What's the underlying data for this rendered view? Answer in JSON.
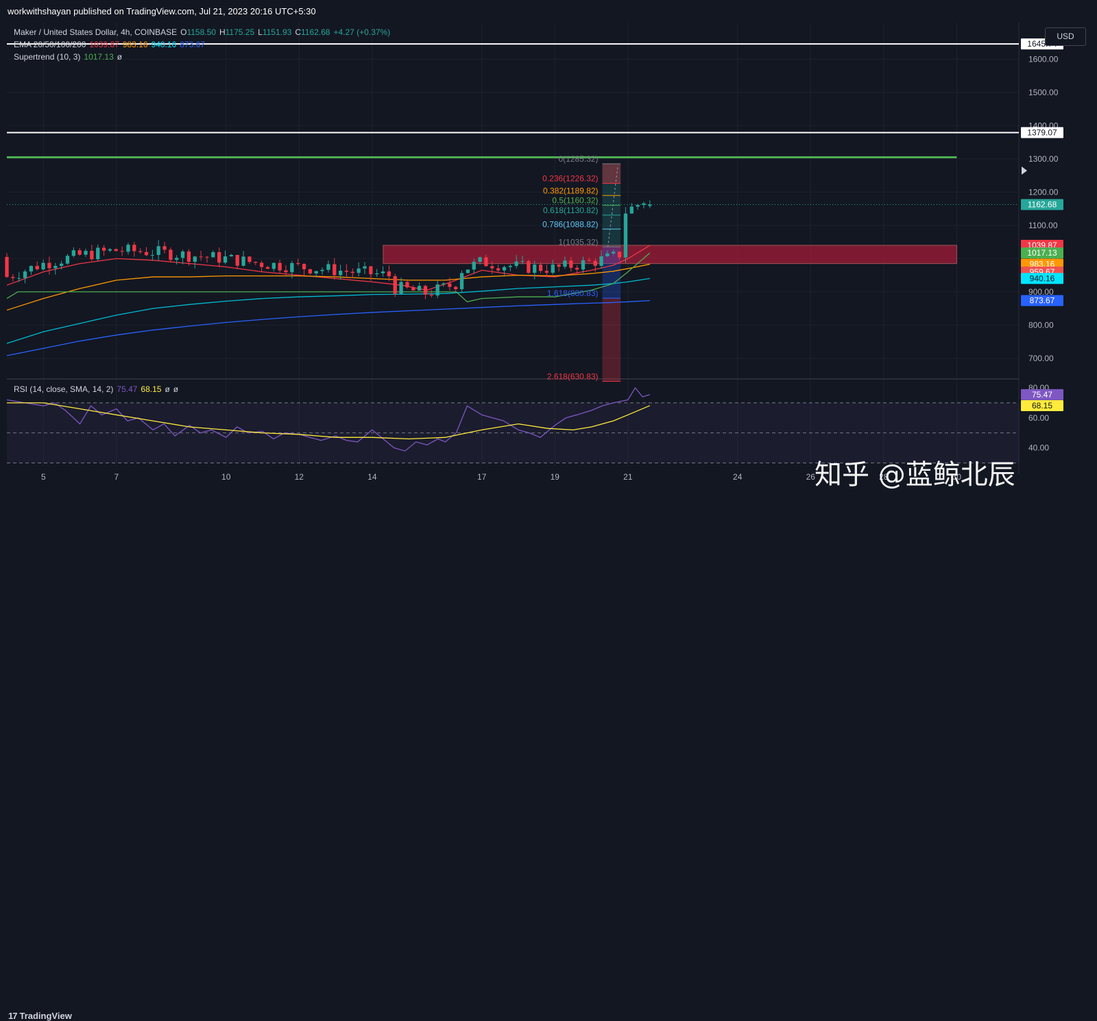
{
  "header": {
    "published_text": "workwithshayan published on TradingView.com, Jul 21, 2023 20:16 UTC+5:30"
  },
  "legend": {
    "symbol": "Maker / United States Dollar, 4h, COINBASE",
    "open_label": "O",
    "open": "1158.50",
    "high_label": "H",
    "high": "1175.25",
    "low_label": "L",
    "low": "1151.93",
    "close_label": "C",
    "close": "1162.68",
    "change": "+4.27 (+0.37%)",
    "ema_label": "EMA 20/50/100/200",
    "ema20": "1039.87",
    "ema50": "983.16",
    "ema100": "940.16",
    "ema200": "873.67",
    "supertrend_label": "Supertrend (10, 3)",
    "supertrend": "1017.13",
    "null_glyph": "ø",
    "rsi_label": "RSI (14, close, SMA, 14, 2)",
    "rsi": "75.47",
    "rsi_sma": "68.15"
  },
  "currency_button": "USD",
  "watermark": "知乎 @蓝鲸北辰",
  "footer": {
    "brand_mark": "17",
    "brand": "TradingView"
  },
  "colors": {
    "up": "#26a69a",
    "down": "#f23645",
    "ema20": "#f23645",
    "ema50": "#ff9800",
    "ema100": "#00bcd4",
    "ema200": "#2962ff",
    "supertrend": "#4caf50",
    "rsi": "#7e57c2",
    "rsi_sma": "#ffeb3b"
  },
  "chart_data": [
    {
      "type": "candlestick",
      "title": "Maker / United States Dollar, 4h, COINBASE",
      "ylim": [
        640,
        1710
      ],
      "y_ticks": [
        700,
        800,
        900,
        1000,
        1100,
        1200,
        1300,
        1400,
        1500,
        1600
      ],
      "y_tick_labels": [
        "700.00",
        "800.00",
        "900.00",
        "1000.00",
        "1100.00",
        "1200.00",
        "1300.00",
        "1400.00",
        "1500.00",
        "1600.00"
      ],
      "x_ticks": [
        {
          "day": 5,
          "label": "5"
        },
        {
          "day": 7,
          "label": "7"
        },
        {
          "day": 10,
          "label": "10"
        },
        {
          "day": 12,
          "label": "12"
        },
        {
          "day": 14,
          "label": "14"
        },
        {
          "day": 17,
          "label": "17"
        },
        {
          "day": 19,
          "label": "19"
        },
        {
          "day": 21,
          "label": "21"
        },
        {
          "day": 24,
          "label": "24"
        },
        {
          "day": 26,
          "label": "26"
        },
        {
          "day": 28,
          "label": "28"
        },
        {
          "day": 30,
          "label": "30"
        }
      ],
      "horizontal_levels": [
        {
          "value": 1645.74,
          "label": "1645.74",
          "color": "#ffffff"
        },
        {
          "value": 1379.07,
          "label": "1379.07",
          "color": "#ffffff"
        },
        {
          "value": 1305,
          "label": "",
          "color": "#4caf50"
        }
      ],
      "price_labels": [
        {
          "value": 1162.68,
          "label": "1162.68",
          "color": "#26a69a"
        },
        {
          "value": 1039.87,
          "label": "1039.87",
          "color": "#f23645"
        },
        {
          "value": 1017.13,
          "label": "1017.13",
          "color": "#4caf50"
        },
        {
          "value": 983.16,
          "label": "983.16",
          "color": "#ff9800"
        },
        {
          "value": 959.67,
          "label": "959.67",
          "color": "#ef5350"
        },
        {
          "value": 940.16,
          "label": "940.16",
          "color": "#00e5ff"
        },
        {
          "value": 873.67,
          "label": "873.67",
          "color": "#2962ff"
        }
      ],
      "fib_levels": [
        {
          "ratio": "0",
          "price": 1285.32,
          "label": "0(1285.32)",
          "color": "#787b86"
        },
        {
          "ratio": "0.236",
          "price": 1226.32,
          "label": "0.236(1226.32)",
          "color": "#f23645"
        },
        {
          "ratio": "0.382",
          "price": 1189.82,
          "label": "0.382(1189.82)",
          "color": "#ff9800"
        },
        {
          "ratio": "0.5",
          "price": 1160.32,
          "label": "0.5(1160.32)",
          "color": "#4caf50"
        },
        {
          "ratio": "0.618",
          "price": 1130.82,
          "label": "0.618(1130.82)",
          "color": "#26a69a"
        },
        {
          "ratio": "0.786",
          "price": 1088.82,
          "label": "0.786(1088.82)",
          "color": "#5ec8f5"
        },
        {
          "ratio": "1",
          "price": 1035.32,
          "label": "1(1035.32)",
          "color": "#787b86"
        },
        {
          "ratio": "1.618",
          "price": 880.83,
          "label": "1.618(880.83)",
          "color": "#2962ff"
        },
        {
          "ratio": "2.618",
          "price": 630.83,
          "label": "2.618(630.83)",
          "color": "#f23645"
        }
      ],
      "zone": {
        "from_day": 14.3,
        "to_day": 30.0,
        "top": 1040,
        "bottom": 985
      },
      "candles_summary": {
        "first_day": 4.0,
        "last_day": 21.6,
        "count": 107,
        "last": {
          "open": 1158.5,
          "high": 1175.25,
          "low": 1151.93,
          "close": 1162.68
        }
      },
      "ema_series": [
        {
          "name": "EMA 20",
          "color": "#f23645",
          "x": [
            4.0,
            5.0,
            6.0,
            7.0,
            8.0,
            9.0,
            10.0,
            11.0,
            12.0,
            13.0,
            14.0,
            14.8,
            15.5,
            16.3,
            17.0,
            18.0,
            19.0,
            20.0,
            20.6,
            21.0,
            21.6
          ],
          "y": [
            920,
            960,
            985,
            1000,
            995,
            985,
            975,
            960,
            950,
            940,
            930,
            920,
            905,
            935,
            965,
            950,
            945,
            965,
            980,
            1000,
            1039.87
          ]
        },
        {
          "name": "EMA 50",
          "color": "#ff9800",
          "x": [
            4.0,
            5.0,
            6.0,
            7.0,
            8.0,
            9.0,
            10.0,
            11.0,
            12.0,
            13.0,
            14.0,
            15.0,
            16.0,
            17.0,
            18.0,
            19.0,
            20.0,
            20.6,
            21.0,
            21.6
          ],
          "y": [
            845,
            880,
            910,
            935,
            945,
            945,
            948,
            948,
            948,
            945,
            940,
            935,
            935,
            945,
            950,
            948,
            955,
            962,
            970,
            983.16
          ]
        },
        {
          "name": "EMA 100",
          "color": "#00bcd4",
          "x": [
            4.0,
            5.0,
            6.0,
            7.0,
            8.0,
            9.0,
            10.0,
            11.0,
            12.0,
            13.0,
            14.0,
            15.0,
            16.0,
            17.0,
            18.0,
            19.0,
            20.0,
            20.6,
            21.0,
            21.6
          ],
          "y": [
            745,
            780,
            805,
            830,
            850,
            862,
            872,
            880,
            885,
            888,
            892,
            893,
            895,
            902,
            910,
            915,
            920,
            925,
            930,
            940.16
          ]
        },
        {
          "name": "EMA 200",
          "color": "#2962ff",
          "x": [
            4.0,
            5.0,
            6.0,
            7.0,
            8.0,
            9.0,
            10.0,
            11.0,
            12.0,
            13.0,
            14.0,
            15.0,
            16.0,
            17.0,
            18.0,
            19.0,
            20.0,
            20.6,
            21.0,
            21.6
          ],
          "y": [
            708,
            730,
            752,
            770,
            785,
            797,
            808,
            817,
            825,
            832,
            838,
            843,
            848,
            853,
            858,
            862,
            866,
            868,
            870,
            873.67
          ]
        }
      ],
      "supertrend_series": {
        "name": "Supertrend (10, 3)",
        "color": "#4caf50",
        "x": [
          4.0,
          4.3,
          8.0,
          10.0,
          12.0,
          14.0,
          15.0,
          16.3,
          16.6,
          17.0,
          18.0,
          19.0,
          20.0,
          20.6,
          21.0,
          21.6
        ],
        "y": [
          880,
          900,
          900,
          900,
          900,
          900,
          900,
          900,
          870,
          880,
          885,
          885,
          905,
          925,
          960,
          1017.13
        ]
      }
    },
    {
      "type": "line",
      "title": "RSI (14, close, SMA, 14, 2)",
      "ylim": [
        28,
        85
      ],
      "y_ticks": [
        40,
        60,
        80
      ],
      "y_tick_labels": [
        "40.00",
        "60.00",
        "80.00"
      ],
      "bands": [
        70,
        50,
        30
      ],
      "series": [
        {
          "name": "RSI",
          "color": "#7e57c2",
          "x": [
            4.0,
            4.5,
            5.0,
            5.3,
            5.6,
            6.0,
            6.3,
            6.6,
            7.0,
            7.3,
            7.6,
            8.0,
            8.3,
            8.6,
            9.0,
            9.3,
            9.6,
            10.0,
            10.3,
            10.6,
            11.0,
            11.3,
            11.6,
            12.0,
            12.3,
            12.6,
            13.0,
            13.3,
            13.6,
            14.0,
            14.3,
            14.6,
            14.9,
            15.2,
            15.5,
            15.8,
            16.0,
            16.3,
            16.6,
            17.0,
            17.3,
            17.6,
            18.0,
            18.3,
            18.6,
            19.0,
            19.3,
            19.6,
            20.0,
            20.3,
            20.6,
            21.0,
            21.2,
            21.4,
            21.6
          ],
          "y": [
            72,
            70,
            68,
            70,
            65,
            56,
            68,
            62,
            66,
            58,
            60,
            52,
            56,
            48,
            55,
            50,
            52,
            47,
            54,
            50,
            51,
            46,
            50,
            49,
            47,
            45,
            48,
            45,
            44,
            52,
            46,
            40,
            38,
            44,
            42,
            46,
            44,
            50,
            68,
            62,
            60,
            58,
            52,
            50,
            47,
            55,
            60,
            62,
            65,
            68,
            70,
            72,
            80,
            74,
            75.47
          ]
        },
        {
          "name": "RSI-based MA",
          "color": "#ffeb3b",
          "x": [
            4.0,
            5.0,
            6.0,
            7.0,
            8.0,
            9.0,
            10.0,
            11.0,
            12.0,
            13.0,
            14.0,
            15.0,
            16.0,
            17.0,
            18.0,
            18.8,
            19.5,
            20.0,
            20.6,
            21.0,
            21.6
          ],
          "y": [
            70,
            70,
            66,
            62,
            58,
            54,
            52,
            50,
            49,
            47,
            47,
            46,
            47,
            52,
            56,
            53,
            52,
            54,
            58,
            62,
            68.15
          ]
        }
      ]
    }
  ]
}
